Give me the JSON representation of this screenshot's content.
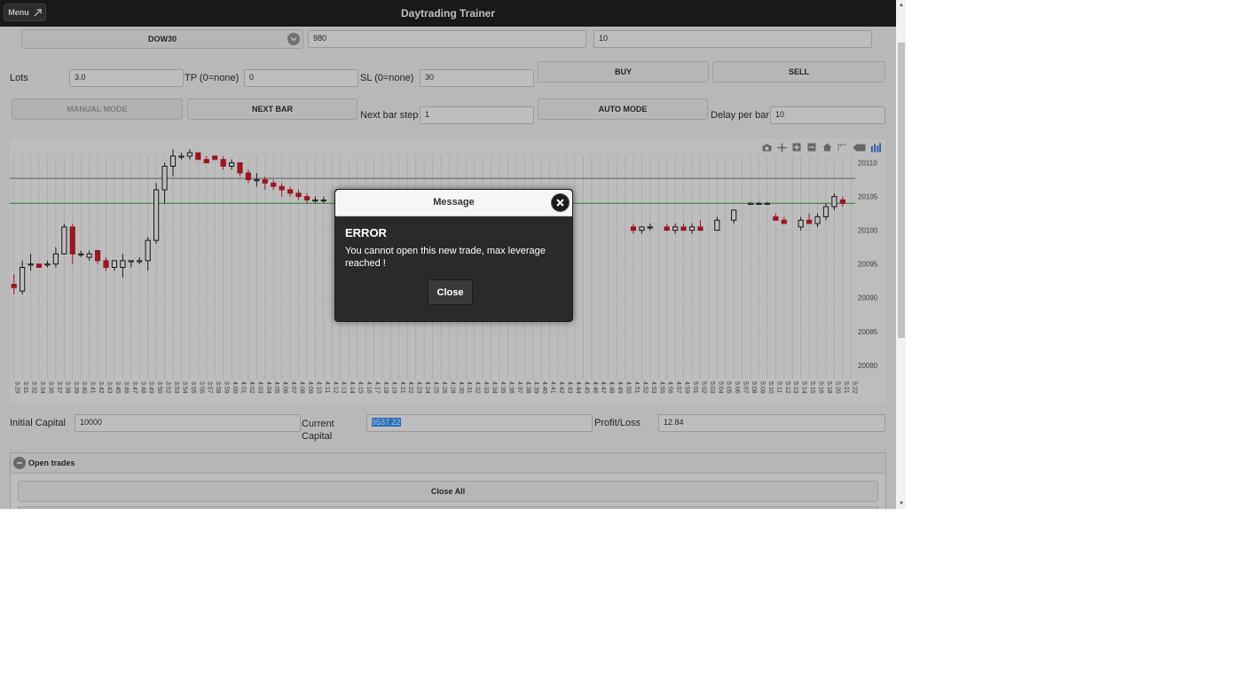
{
  "header": {
    "title": "Daytrading Trainer",
    "menu_label": "Menu"
  },
  "row1": {
    "symbol": "DOW30",
    "field2": "980",
    "field3": "10"
  },
  "row2": {
    "lots_label": "Lots",
    "lots_value": "3.0",
    "tp_label": "TP (0=none)",
    "tp_value": "0",
    "sl_label": "SL (0=none)",
    "sl_value": "30",
    "buy_label": "BUY",
    "sell_label": "SELL"
  },
  "row3": {
    "manual_label": "MANUAL MODE",
    "next_bar_label": "NEXT BAR",
    "next_bar_step_label": "Next bar step",
    "next_bar_step_value": "1",
    "auto_label": "AUTO MODE",
    "delay_label": "Delay per bar",
    "delay_value": "10"
  },
  "chart_modebar": [
    "camera-icon",
    "pan-icon",
    "zoom-in-icon",
    "zoom-out-icon",
    "home-icon",
    "spike-lines-icon",
    "hover-closest-icon",
    "plotly-logo-icon"
  ],
  "chart_data": {
    "type": "candlestick",
    "title": "",
    "xlabel": "",
    "ylabel": "",
    "ylim": [
      20078,
      20111
    ],
    "y_ticks": [
      "20110",
      "20105",
      "20100",
      "20095",
      "20090",
      "20085",
      "20080"
    ],
    "x": [
      "3:29",
      "3:31",
      "3:32",
      "3:34",
      "3:36",
      "3:37",
      "3:38",
      "3:39",
      "3:40",
      "3:41",
      "3:42",
      "3:43",
      "3:45",
      "3:46",
      "3:47",
      "3:48",
      "3:49",
      "3:50",
      "3:52",
      "3:53",
      "3:54",
      "3:55",
      "3:56",
      "3:57",
      "3:58",
      "3:59",
      "4:00",
      "4:01",
      "4:02",
      "4:03",
      "4:04",
      "4:05",
      "4:06",
      "4:07",
      "4:08",
      "4:09",
      "4:10",
      "4:11",
      "4:12",
      "4:13",
      "4:14",
      "4:15",
      "4:16",
      "4:17",
      "4:18",
      "4:19",
      "4:21",
      "4:22",
      "4:23",
      "4:24",
      "4:25",
      "4:26",
      "4:28",
      "4:30",
      "4:31",
      "4:32",
      "4:33",
      "4:34",
      "4:35",
      "4:36",
      "4:37",
      "4:38",
      "4:39",
      "4:40",
      "4:41",
      "4:42",
      "4:43",
      "4:44",
      "4:45",
      "4:46",
      "4:47",
      "4:48",
      "4:49",
      "4:50",
      "4:51",
      "4:52",
      "4:53",
      "4:55",
      "4:56",
      "4:57",
      "4:59",
      "5:01",
      "5:02",
      "5:03",
      "5:04",
      "5:05",
      "5:06",
      "5:07",
      "5:08",
      "5:09",
      "5:10",
      "5:11",
      "5:12",
      "5:13",
      "5:14",
      "5:15",
      "5:16",
      "5:18",
      "5:20",
      "5:21",
      "5:22"
    ],
    "series": [
      {
        "values": [
          [
            20092.0,
            20093.5,
            20090.5,
            20091.5
          ],
          [
            20091.0,
            20095.5,
            20090.5,
            20094.5
          ],
          [
            20095.0,
            20096.5,
            20094.0,
            20095.0
          ],
          [
            20095.0,
            20095.0,
            20094.5,
            20094.5
          ],
          [
            20095.0,
            20095.5,
            20094.5,
            20095.0
          ],
          [
            20095.0,
            20097.5,
            20094.5,
            20096.5
          ],
          [
            20096.5,
            20101.0,
            20096.5,
            20100.5
          ],
          [
            20100.5,
            20101.0,
            20095.0,
            20096.5
          ],
          [
            20096.5,
            20097.0,
            20096.0,
            20096.5
          ],
          [
            20096.0,
            20097.0,
            20095.5,
            20096.5
          ],
          [
            20097.0,
            20097.0,
            20095.0,
            20095.5
          ],
          [
            20095.5,
            20096.0,
            20094.0,
            20094.5
          ],
          [
            20094.5,
            20095.5,
            20094.0,
            20095.5
          ],
          [
            20094.5,
            20096.5,
            20093.0,
            20095.5
          ],
          [
            20095.5,
            20095.5,
            20094.5,
            20095.5
          ],
          [
            20095.5,
            20096.0,
            20095.0,
            20095.5
          ],
          [
            20095.5,
            20099.0,
            20094.0,
            20098.5
          ],
          [
            20098.5,
            20107.0,
            20098.0,
            20106.0
          ],
          [
            20106.0,
            20110.0,
            20104.0,
            20109.5
          ],
          [
            20109.5,
            20112.0,
            20108.0,
            20111.0
          ],
          [
            20111.0,
            20111.5,
            20110.5,
            20111.0
          ],
          [
            20111.0,
            20112.0,
            20110.5,
            20111.5
          ],
          [
            20111.5,
            20111.5,
            20110.5,
            20110.5
          ],
          [
            20110.5,
            20111.0,
            20110.0,
            20110.0
          ],
          [
            20111.0,
            20111.0,
            20110.5,
            20110.5
          ],
          [
            20110.5,
            20111.0,
            20109.0,
            20109.5
          ],
          [
            20109.5,
            20110.5,
            20109.0,
            20110.0
          ],
          [
            20110.0,
            20110.0,
            20108.0,
            20108.5
          ],
          [
            20108.5,
            20109.0,
            20107.0,
            20107.5
          ],
          [
            20107.5,
            20108.5,
            20106.5,
            20107.5
          ],
          [
            20107.5,
            20108.0,
            20106.0,
            20107.0
          ],
          [
            20107.0,
            20107.5,
            20106.0,
            20106.5
          ],
          [
            20106.5,
            20107.0,
            20105.0,
            20106.0
          ],
          [
            20106.0,
            20106.5,
            20105.0,
            20105.5
          ],
          [
            20105.5,
            20106.0,
            20104.5,
            20105.0
          ],
          [
            20105.0,
            20105.5,
            20104.0,
            20104.5
          ],
          [
            20104.5,
            20105.0,
            20104.0,
            20104.5
          ],
          [
            20104.5,
            20105.0,
            20104.0,
            20104.5
          ]
        ]
      }
    ],
    "horizontal_lines": [
      20104.0,
      20107.7
    ]
  },
  "bottom": {
    "initial_capital_label": "Initial Capital",
    "initial_capital_value": "10000",
    "current_capital_label": "Current Capital",
    "current_capital_value": "9537.22",
    "pl_label": "Profit/Loss",
    "pl_value": "12.84"
  },
  "open_trades": {
    "title": "Open trades",
    "close_all_label": "Close All"
  },
  "dialog": {
    "header": "Message",
    "title": "ERROR",
    "message": "You cannot open this new trade, max leverage reached !",
    "close_label": "Close"
  },
  "colors": {
    "up": "#222222",
    "down": "#cc1f2f",
    "green_line": "#3cb043",
    "gray_line": "#808080",
    "header_bg": "#232323"
  }
}
